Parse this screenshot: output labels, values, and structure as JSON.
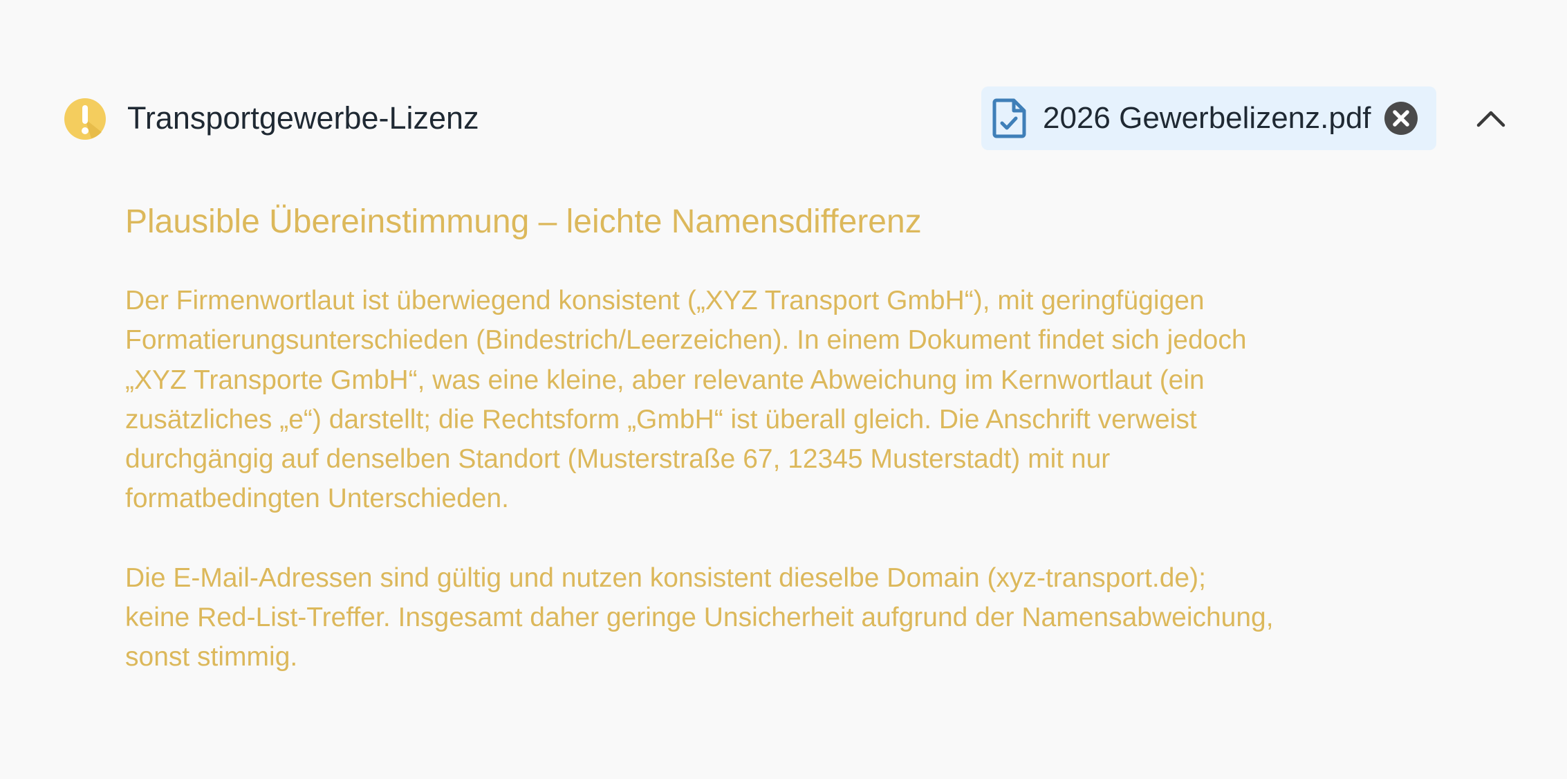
{
  "section": {
    "title": "Transportgewerbe-Lizenz",
    "status_icon": "warning-icon",
    "attachment": {
      "file_name": "2026 Gewerbelizenz.pdf",
      "file_icon": "document-check-icon",
      "remove_icon": "close-circle-icon"
    },
    "collapse_icon": "chevron-up-icon"
  },
  "assessment": {
    "headline": "Plausible Übereinstimmung – leichte Namensdifferenz",
    "paragraph1_lines": [
      "Der Firmenwortlaut ist überwiegend konsistent („XYZ Transport GmbH“), mit geringfügigen",
      "Formatierungsunterschieden (Bindestrich/Leerzeichen). In einem Dokument findet sich jedoch",
      "„XYZ Transporte GmbH“, was eine kleine, aber relevante Abweichung im Kernwortlaut (ein",
      "zusätzliches „e“) darstellt; die Rechtsform „GmbH“ ist überall gleich. Die Anschrift verweist",
      "durchgängig auf denselben Standort (Musterstraße 67, 12345 Musterstadt) mit nur",
      "formatbedingten Unterschieden."
    ],
    "paragraph2_lines": [
      "Die E-Mail-Adressen sind gültig und nutzen konsistent dieselbe Domain (xyz-transport.de);",
      "keine Red-List-Treffer. Insgesamt daher geringe Unsicherheit aufgrund der Namensabweichung,",
      "sonst stimmig."
    ]
  },
  "colors": {
    "background": "#f9f9f9",
    "warning": "#f4cd5e",
    "assessment_text": "#dcb85b",
    "chip_background": "#e6f2fd",
    "file_icon": "#3f7fb8"
  }
}
